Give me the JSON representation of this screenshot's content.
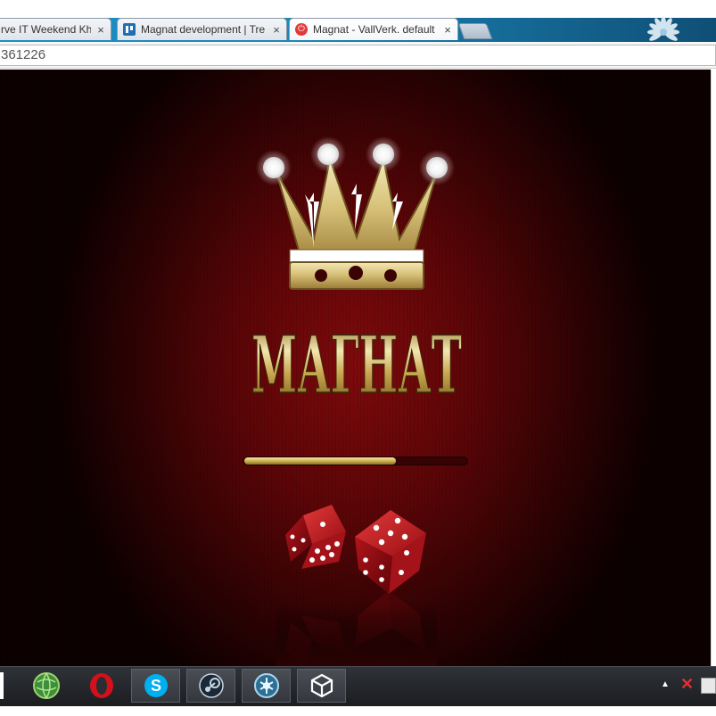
{
  "browser": {
    "tabs": [
      {
        "title": "rve IT Weekend Kha",
        "close": "×",
        "favicon": "none"
      },
      {
        "title": "Magnat development | Tre",
        "close": "×",
        "favicon": "trello-icon"
      },
      {
        "title": "Magnat - VallVerk. default",
        "close": "×",
        "favicon": "power-icon",
        "active": true
      }
    ],
    "address_value": "361226"
  },
  "game": {
    "logo_text": "МАГНАТ",
    "loading_progress": 0.68,
    "colors": {
      "background": "#5a0507",
      "gold": "#d8c27a",
      "dice": "#b3141c"
    }
  },
  "taskbar": {
    "items": [
      {
        "name": "globe-app-icon",
        "pinned": false
      },
      {
        "name": "opera-icon",
        "pinned": false
      },
      {
        "name": "skype-icon",
        "pinned": true
      },
      {
        "name": "steam-icon",
        "pinned": true
      },
      {
        "name": "network-app-icon",
        "pinned": true
      },
      {
        "name": "unity-icon",
        "pinned": true
      }
    ],
    "tray": {
      "up_arrow": "▲",
      "x_glyph": "✕"
    }
  }
}
